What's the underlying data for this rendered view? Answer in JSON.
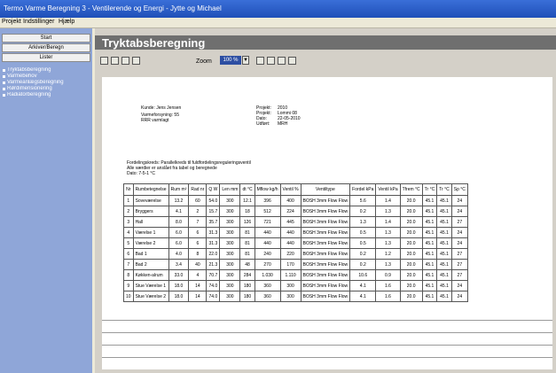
{
  "window": {
    "title": "Termo Varme Beregning 3 - Ventilerende og Energi - Jytte og Michael"
  },
  "menu": [
    "Projekt",
    "Indstillinger",
    "Hjælp"
  ],
  "sidebar": {
    "buttons": [
      "Start",
      "Arkiver/Beregn",
      "Lister"
    ],
    "items": [
      "Tryktabsberegning",
      "Varmebehov",
      "Varmeanlægsberegning",
      "Rørdimensionering",
      "Radiatorberegning"
    ]
  },
  "page": {
    "title": "Tryktabsberegning"
  },
  "toolbar": {
    "zoom_label": "Zoom",
    "zoom_value": "100 %"
  },
  "report": {
    "left_info": [
      "Kunde: Jens Jensen",
      "Varmeforsyning: 55",
      "RRR varmlagt"
    ],
    "right_labels": [
      "Projekt:",
      "Projekt:",
      "Dato:",
      "Udført:"
    ],
    "right_values": [
      "2010",
      "Lommi 08",
      "22-05-2010",
      "MRH"
    ],
    "subtitle_lines": [
      "Fordelingskreds: Parallelkreds til fuldfordelingsreguleringsventil",
      "Alle værdier er anslået fra tabel og beregnede",
      "Dato: 7-5-1 °C"
    ],
    "columns": [
      "Nr",
      "Rumbetegnelse",
      "Rum m²",
      "Rad nr",
      "Q W",
      "Len mm",
      "dt °C",
      "Mflow kg/h",
      "Ventil %",
      "Ventiltype",
      "Fordel kPa",
      "Ventil kPa",
      "Tfrem °C",
      "Tr °C",
      "Tr °C",
      "Sp °C"
    ],
    "rows": [
      [
        "1",
        "Soveværelse",
        "13.2",
        "60",
        "54.0",
        "300",
        "12.1",
        "396",
        "400",
        "BOSH 3mm Flow Flow",
        "5.6",
        "1.4",
        "20.0",
        "45.1",
        "45.1",
        "24"
      ],
      [
        "2",
        "Bryggers",
        "4.1",
        "2",
        "15.7",
        "300",
        "18",
        "512",
        "224",
        "BOSH 3mm Flow Flow",
        "0.2",
        "1.3",
        "20.0",
        "45.1",
        "45.1",
        "24"
      ],
      [
        "3",
        "Hall",
        "8.0",
        "7",
        "35.7",
        "300",
        "126",
        "721",
        "445",
        "BOSH 3mm Flow Flow",
        "1.3",
        "1.4",
        "20.0",
        "45.1",
        "45.1",
        "27"
      ],
      [
        "4",
        "Værelse 1",
        "6.0",
        "6",
        "31.3",
        "300",
        "81",
        "440",
        "440",
        "BOSH 3mm Flow Flow",
        "0.5",
        "1.3",
        "20.0",
        "45.1",
        "45.1",
        "24"
      ],
      [
        "5",
        "Værelse 2",
        "6.0",
        "6",
        "31.3",
        "300",
        "81",
        "440",
        "440",
        "BOSH 3mm Flow Flow",
        "0.5",
        "1.3",
        "20.0",
        "45.1",
        "45.1",
        "24"
      ],
      [
        "6",
        "Bad 1",
        "4.0",
        "8",
        "22.0",
        "300",
        "81",
        "240",
        "220",
        "BOSH 3mm Flow Flow",
        "0.2",
        "1.2",
        "20.0",
        "45.1",
        "45.1",
        "27"
      ],
      [
        "7",
        "Bad 2",
        "3.4",
        "40",
        "21.3",
        "300",
        "48",
        "270",
        "170",
        "BOSH 3mm Flow Flow",
        "0.2",
        "1.3",
        "20.0",
        "45.1",
        "45.1",
        "27"
      ],
      [
        "8",
        "Køkken-alrum",
        "33.0",
        "4",
        "70.7",
        "300",
        "284",
        "1.030",
        "1.110",
        "BOSH 3mm Flow Flow",
        "10.6",
        "0.9",
        "20.0",
        "45.1",
        "45.1",
        "27"
      ],
      [
        "9",
        "Stue Værelse 1",
        "18.0",
        "14",
        "74.0",
        "300",
        "180",
        "360",
        "300",
        "BOSH 3mm Flow Flow",
        "4.1",
        "1.6",
        "20.0",
        "45.1",
        "45.1",
        "24"
      ],
      [
        "10",
        "Stue Værelse 2",
        "18.0",
        "14",
        "74.0",
        "300",
        "180",
        "360",
        "300",
        "BOSH 3mm Flow Flow",
        "4.1",
        "1.6",
        "20.0",
        "45.1",
        "45.1",
        "24"
      ]
    ]
  }
}
